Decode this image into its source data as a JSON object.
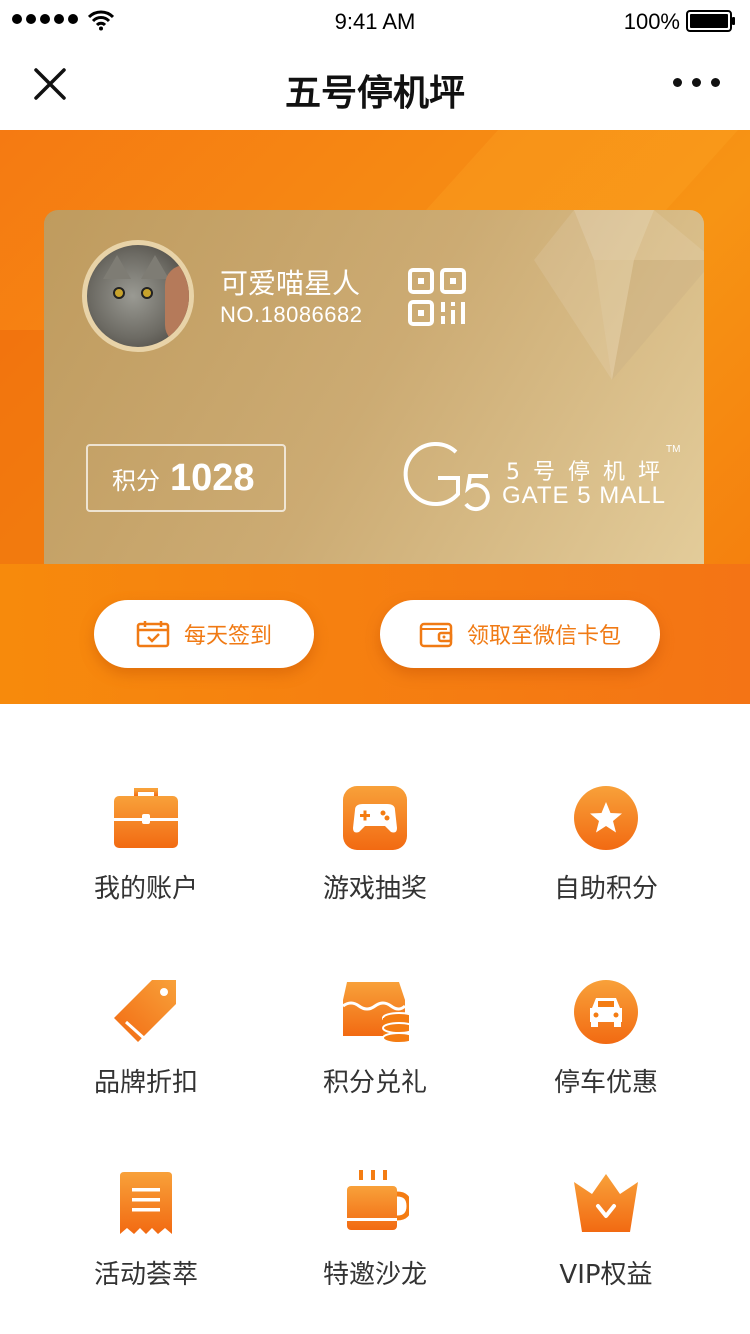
{
  "status_bar": {
    "time": "9:41 AM",
    "battery": "100%",
    "icons": [
      "signal-dots-icon",
      "wifi-icon",
      "battery-icon"
    ]
  },
  "nav": {
    "title": "五号停机坪",
    "left_icon": "close-icon",
    "right_icon": "more-icon"
  },
  "card": {
    "user_name": "可爱喵星人",
    "user_no": "NO.18086682",
    "qr_icon": "qr-code-icon",
    "points_label": "积分",
    "points_value": "1028",
    "brand_cn": "5号停机坪",
    "brand_en": "GATE 5 MALL",
    "brand_tm": "TM",
    "colors": {
      "gold_start": "#bf9b5e",
      "gold_end": "#e3cc9a"
    }
  },
  "actions": {
    "checkin_label": "每天签到",
    "wechat_label": "领取至微信卡包"
  },
  "menu": [
    {
      "label": "我的账户",
      "icon": "briefcase-icon"
    },
    {
      "label": "游戏抽奖",
      "icon": "gamepad-icon"
    },
    {
      "label": "自助积分",
      "icon": "star-icon"
    },
    {
      "label": "品牌折扣",
      "icon": "tag-icon"
    },
    {
      "label": "积分兑礼",
      "icon": "shop-coins-icon"
    },
    {
      "label": "停车优惠",
      "icon": "car-icon"
    },
    {
      "label": "活动荟萃",
      "icon": "receipt-icon"
    },
    {
      "label": "特邀沙龙",
      "icon": "coffee-cup-icon"
    },
    {
      "label": "VIP权益",
      "icon": "crown-icon"
    }
  ],
  "theme": {
    "accent": "#f47c12",
    "accent_light": "#f8a13a",
    "text": "#333333"
  }
}
